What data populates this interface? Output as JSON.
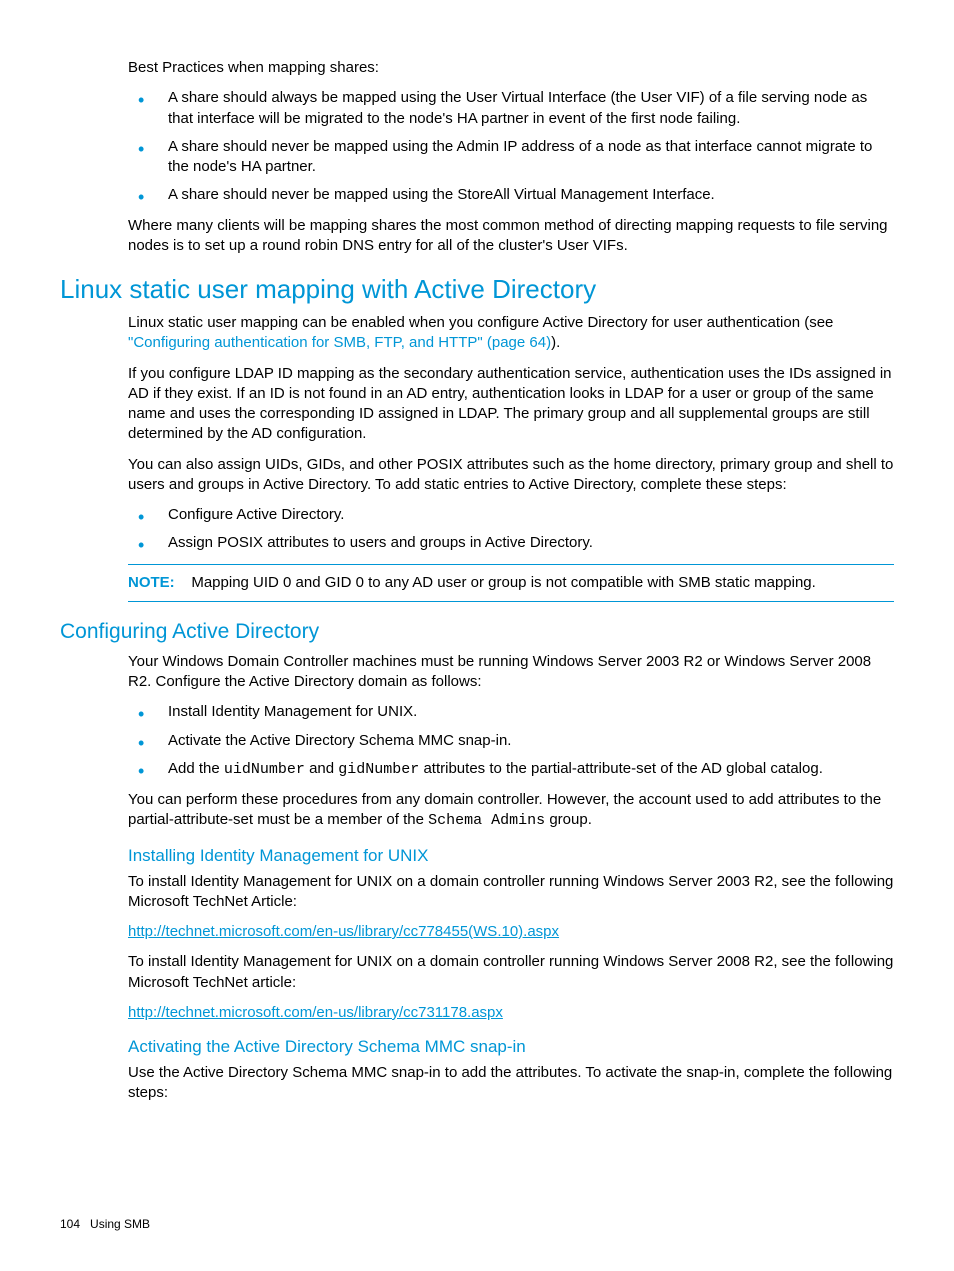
{
  "intro": {
    "best_practices_heading": "Best Practices when mapping shares:",
    "bullets": [
      "A share should always be mapped using the User Virtual Interface (the User VIF) of a file serving node as that interface will be migrated to the node's HA partner in event of the first node failing.",
      "A share should never be mapped using the Admin IP address of a node as that interface cannot migrate to the node's HA partner.",
      "A share should never be mapped using the StoreAll Virtual Management Interface."
    ],
    "closing": "Where many clients will be mapping shares the most common method of directing mapping requests to file serving nodes is to set up a round robin DNS entry for all of the cluster's User VIFs."
  },
  "section1": {
    "title": "Linux static user mapping with Active Directory",
    "p1_a": "Linux static user mapping can be enabled when you configure Active Directory for user authentication (see ",
    "p1_link": "\"Configuring authentication for SMB, FTP, and HTTP\" (page 64)",
    "p1_b": ").",
    "p2": "If you configure LDAP ID mapping as the secondary authentication service, authentication uses the IDs assigned in AD if they exist. If an ID is not found in an AD entry, authentication looks in LDAP for a user or group of the same name and uses the corresponding ID assigned in LDAP. The primary group and all supplemental groups are still determined by the AD configuration.",
    "p3": "You can also assign UIDs, GIDs, and other POSIX attributes such as the home directory, primary group and shell to users and groups in Active Directory. To add static entries to Active Directory, complete these steps:",
    "bullets": [
      "Configure Active Directory.",
      "Assign POSIX attributes to users and groups in Active Directory."
    ],
    "note_label": "NOTE:",
    "note_text": "Mapping UID 0 and GID 0 to any AD user or group is not compatible with SMB static mapping."
  },
  "section2": {
    "title": "Configuring Active Directory",
    "p1": "Your Windows Domain Controller machines must be running Windows Server 2003 R2 or Windows Server 2008 R2. Configure the Active Directory domain as follows:",
    "bullet1": "Install Identity Management for UNIX.",
    "bullet2": "Activate the Active Directory Schema MMC snap-in.",
    "bullet3_a": "Add the ",
    "bullet3_code1": "uidNumber",
    "bullet3_b": " and ",
    "bullet3_code2": "gidNumber",
    "bullet3_c": " attributes to the partial-attribute-set of the AD global catalog.",
    "p2_a": "You can perform these procedures from any domain controller. However, the account used to add attributes to the partial-attribute-set must be a member of the ",
    "p2_code": "Schema Admins",
    "p2_b": " group.",
    "sub1": {
      "title": "Installing Identity Management for UNIX",
      "p1": "To install Identity Management for UNIX on a domain controller running Windows Server 2003 R2, see the following Microsoft TechNet Article:",
      "link1": "http://technet.microsoft.com/en-us/library/cc778455(WS.10).aspx",
      "p2": "To install Identity Management for UNIX on a domain controller running Windows Server 2008 R2, see the following Microsoft TechNet article:",
      "link2": "http://technet.microsoft.com/en-us/library/cc731178.aspx"
    },
    "sub2": {
      "title": "Activating the Active Directory Schema MMC snap-in",
      "p1": "Use the Active Directory Schema MMC snap-in to add the attributes. To activate the snap-in, complete the following steps:"
    }
  },
  "footer": {
    "page": "104",
    "section": "Using SMB"
  }
}
